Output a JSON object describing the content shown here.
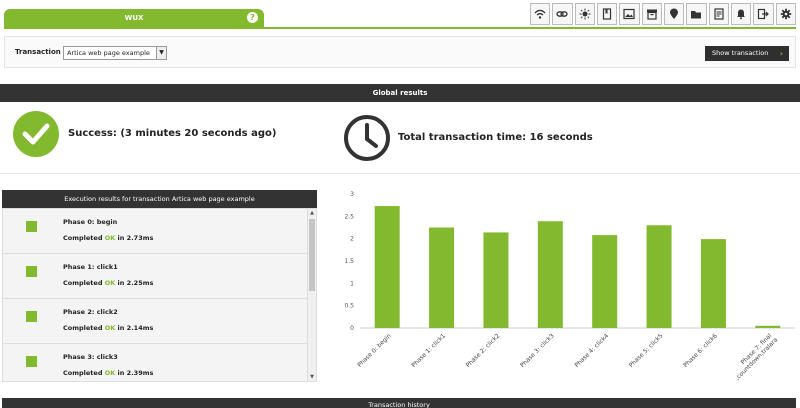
{
  "tab": {
    "title": "WUX",
    "help": "?"
  },
  "toolbar_icons": [
    "wifi-icon",
    "link-icon",
    "sun-icon",
    "bookmark-icon",
    "image-icon",
    "archive-icon",
    "map-pin-icon",
    "folder-icon",
    "note-icon",
    "bell-icon",
    "logout-icon",
    "gear-icon"
  ],
  "transaction": {
    "label": "Transaction",
    "selected": "Artica web page example",
    "show_button": "Show transaction",
    "show_arrow": "›"
  },
  "global": {
    "header": "Global results",
    "success": "Success: (3 minutes 20 seconds ago)",
    "total_time": "Total transaction time: 16 seconds"
  },
  "execution": {
    "header": "Execution results for transaction Artica web page example",
    "phases": [
      {
        "title": "Phase 0: begin",
        "prefix": "Completed ",
        "ok": "OK",
        "suffix": " in 2.73ms"
      },
      {
        "title": "Phase 1: click1",
        "prefix": "Completed ",
        "ok": "OK",
        "suffix": " in 2.25ms"
      },
      {
        "title": "Phase 2: click2",
        "prefix": "Completed ",
        "ok": "OK",
        "suffix": " in 2.14ms"
      },
      {
        "title": "Phase 3: click3",
        "prefix": "Completed ",
        "ok": "OK",
        "suffix": " in 2.39ms"
      }
    ]
  },
  "chart_data": {
    "type": "bar",
    "categories": [
      "Phase 0: begin",
      "Phase 1: click1",
      "Phase 2: click2",
      "Phase 3: click3",
      "Phase 4: click4",
      "Phase 5: click5",
      "Phase 6: click6",
      "Phase 7: final",
      ",countdown,tralara"
    ],
    "values": [
      2.73,
      2.25,
      2.14,
      2.39,
      2.08,
      2.3,
      1.99,
      0.05
    ],
    "y_ticks": [
      "0",
      "0.5",
      "1",
      "1.5",
      "2",
      "2.5",
      "3"
    ],
    "ylim": [
      0,
      3
    ],
    "grid": false,
    "bar_color": "#82b92e"
  },
  "history": {
    "header": "Transaction history"
  },
  "colors": {
    "accent": "#82b92e",
    "dark": "#333333"
  }
}
